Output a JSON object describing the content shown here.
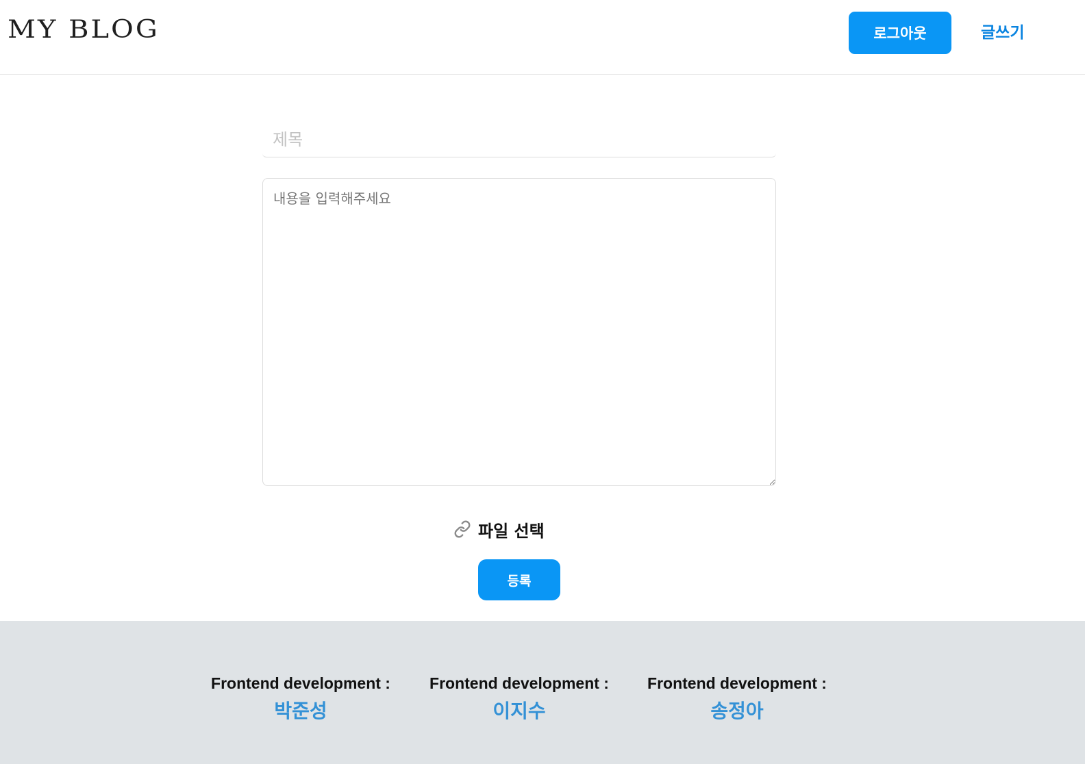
{
  "header": {
    "logo_text": "MY BLOG",
    "logout_label": "로그아웃",
    "write_label": "글쓰기"
  },
  "form": {
    "title_placeholder": "제목",
    "title_value": "",
    "content_placeholder": "내용을 입력해주세요",
    "content_value": "",
    "file_select_icon": "link-icon",
    "file_select_label": "파일 선택",
    "submit_label": "등록"
  },
  "footer": {
    "credits": [
      {
        "role": "Frontend development :",
        "name": "박준성"
      },
      {
        "role": "Frontend development :",
        "name": "이지수"
      },
      {
        "role": "Frontend development :",
        "name": "송정아"
      }
    ]
  },
  "colors": {
    "accent": "#0a96f5",
    "link": "#0a84e0",
    "footer_bg": "#dfe3e6",
    "footer_name": "#3391d6"
  }
}
